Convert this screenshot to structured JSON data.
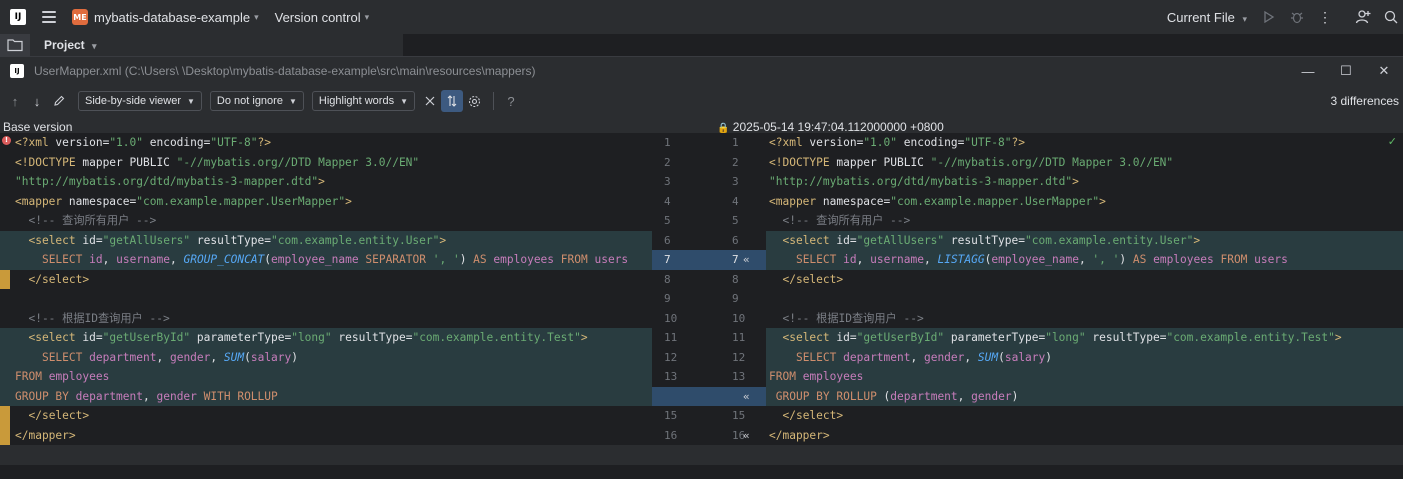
{
  "titlebar": {
    "logo_letters": "IJ",
    "project_badge": "ME",
    "project_name": "mybatis-database-example",
    "version_control": "Version control",
    "current_file": "Current File"
  },
  "project_panel": {
    "label": "Project"
  },
  "diff": {
    "window_title": "UserMapper.xml (C:\\Users\\          \\Desktop\\mybatis-database-example\\src\\main\\resources\\mappers)",
    "viewer_mode": "Side-by-side viewer",
    "ignore_mode": "Do not ignore",
    "highlight_mode": "Highlight words",
    "difference_count": "3 differences",
    "left_header": "Base version",
    "right_header": "2025-05-14 19:47:04.112000000 +0800"
  },
  "gutter": {
    "left_numbers": [
      "1",
      "2",
      "3",
      "4",
      "5",
      "6",
      "7",
      "8",
      "9",
      "10",
      "11",
      "12",
      "13",
      "",
      "15",
      "16"
    ],
    "right_numbers": [
      "1",
      "2",
      "3",
      "4",
      "5",
      "6",
      "7",
      "8",
      "9",
      "10",
      "11",
      "12",
      "13",
      "",
      "15",
      "16"
    ]
  },
  "left_lines": [
    "<?xml version=\"1.0\" encoding=\"UTF-8\"?>",
    "<!DOCTYPE mapper PUBLIC \"-//mybatis.org//DTD Mapper 3.0//EN\"",
    "\"http://mybatis.org/dtd/mybatis-3-mapper.dtd\">",
    "<mapper namespace=\"com.example.mapper.UserMapper\">",
    "  <!-- 查询所有用户 -->",
    "  <select id=\"getAllUsers\" resultType=\"com.example.entity.User\">",
    "    SELECT id, username, GROUP_CONCAT(employee_name SEPARATOR ', ') AS employees FROM users",
    "  </select>",
    "",
    "  <!-- 根据ID查询用户 -->",
    "  <select id=\"getUserById\" parameterType=\"long\" resultType=\"com.example.entity.Test\">",
    "    SELECT department, gender, SUM(salary)",
    "FROM employees",
    "GROUP BY department, gender WITH ROLLUP",
    "  </select>",
    "</mapper>"
  ],
  "right_lines": [
    "<?xml version=\"1.0\" encoding=\"UTF-8\"?>",
    "<!DOCTYPE mapper PUBLIC \"-//mybatis.org//DTD Mapper 3.0//EN\"",
    "\"http://mybatis.org/dtd/mybatis-3-mapper.dtd\">",
    "<mapper namespace=\"com.example.mapper.UserMapper\">",
    "  <!-- 查询所有用户 -->",
    "  <select id=\"getAllUsers\" resultType=\"com.example.entity.User\">",
    "    SELECT id, username, LISTAGG(employee_name, ', ') AS employees FROM users",
    "  </select>",
    "",
    "  <!-- 根据ID查询用户 -->",
    "  <select id=\"getUserById\" parameterType=\"long\" resultType=\"com.example.entity.Test\">",
    "    SELECT department, gender, SUM(salary)",
    "FROM employees",
    " GROUP BY ROLLUP (department, gender)",
    "  </select>",
    "</mapper>"
  ],
  "colors": {
    "background": "#1e1f22",
    "toolbar": "#2b2d30",
    "modified_line": "#293c40",
    "modified_marker": "#c99a3a",
    "gutter_highlight": "#2f4c6b"
  }
}
